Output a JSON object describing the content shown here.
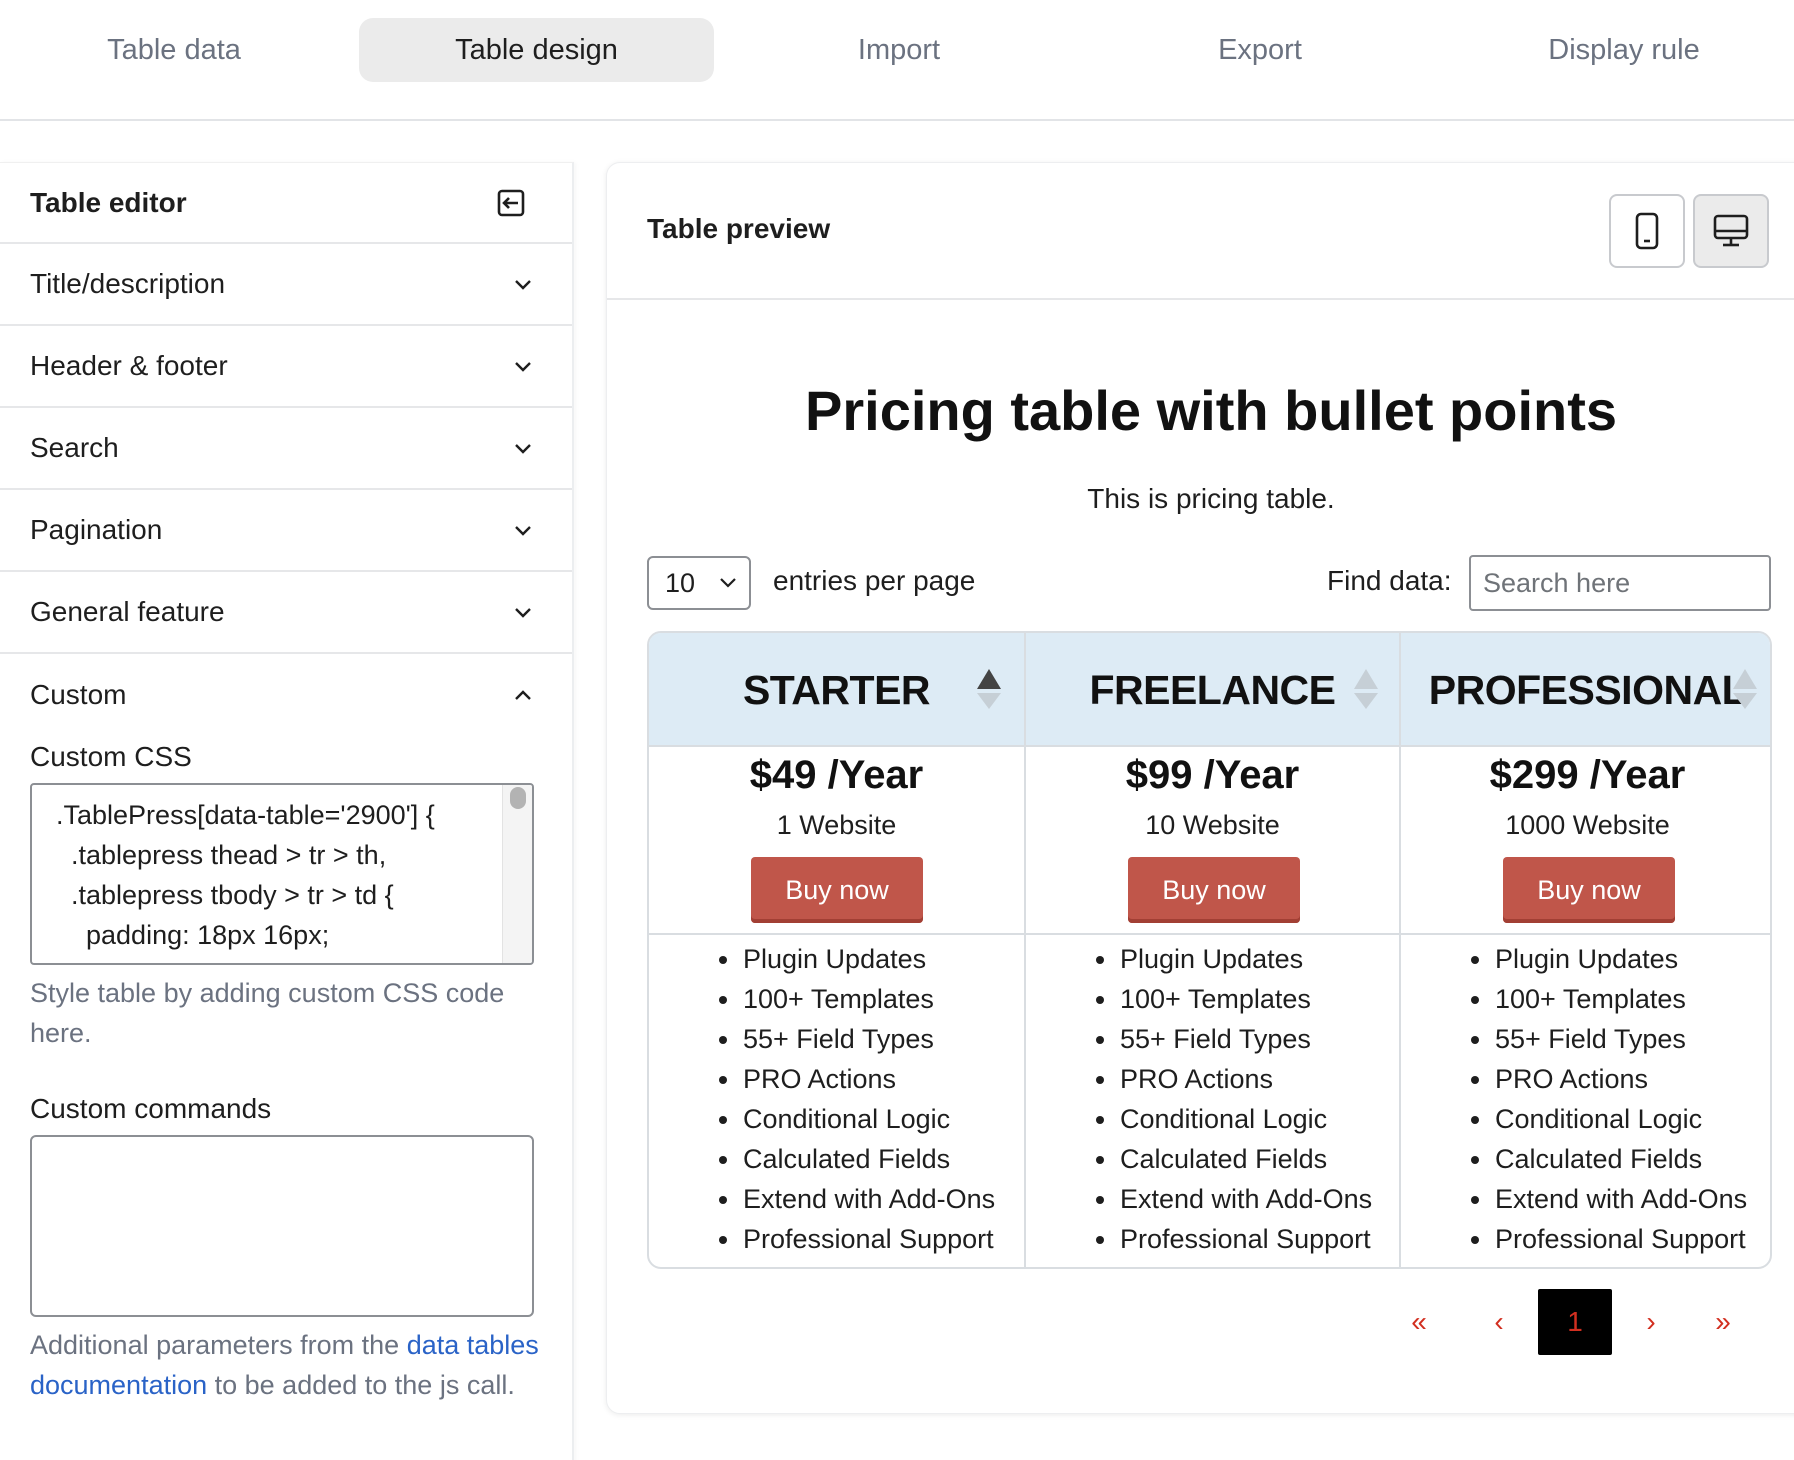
{
  "tabs": [
    {
      "label": "Table data",
      "active": false
    },
    {
      "label": "Table design",
      "active": true
    },
    {
      "label": "Import",
      "active": false
    },
    {
      "label": "Export",
      "active": false
    },
    {
      "label": "Display rule",
      "active": false
    }
  ],
  "editor": {
    "title": "Table editor",
    "collapse_icon": "collapse-panel-icon",
    "sections": [
      {
        "label": "Title/description",
        "open": false
      },
      {
        "label": "Header & footer",
        "open": false
      },
      {
        "label": "Search",
        "open": false
      },
      {
        "label": "Pagination",
        "open": false
      },
      {
        "label": "General feature",
        "open": false
      },
      {
        "label": "Custom",
        "open": true
      }
    ],
    "custom": {
      "css_label": "Custom CSS",
      "css_value": ".TablePress[data-table='2900'] {\n  .tablepress thead > tr > th,\n  .tablepress tbody > tr > td {\n    padding: 18px 16px;",
      "css_help": "Style table by adding custom CSS code here.",
      "commands_label": "Custom commands",
      "commands_value": "",
      "commands_help_pre": "Additional parameters from the ",
      "commands_help_link": "data tables documentation",
      "commands_help_post": " to be added to the js call."
    }
  },
  "preview": {
    "title": "Table preview",
    "mobile_icon": "mobile-icon",
    "desktop_icon": "desktop-icon",
    "table_title": "Pricing table with bullet points",
    "table_description": "This is pricing table.",
    "length_value": "10",
    "length_label": "entries per page",
    "find_label": "Find data:",
    "search_placeholder": "Search here",
    "accent_color": "#c0564a",
    "header_bg": "#ddebf5",
    "columns": [
      {
        "name": "STARTER",
        "sort": "asc",
        "price": "$49 /Year",
        "sites": "1 Website",
        "button": "Buy now",
        "features": [
          "Plugin Updates",
          "100+ Templates",
          "55+ Field Types",
          "PRO Actions",
          "Conditional Logic",
          "Calculated Fields",
          "Extend with Add-Ons",
          "Professional Support"
        ]
      },
      {
        "name": "FREELANCE",
        "sort": "none",
        "price": "$99 /Year",
        "sites": "10 Website",
        "button": "Buy now",
        "features": [
          "Plugin Updates",
          "100+ Templates",
          "55+ Field Types",
          "PRO Actions",
          "Conditional Logic",
          "Calculated Fields",
          "Extend with Add-Ons",
          "Professional Support"
        ]
      },
      {
        "name": "PROFESSIONAL",
        "sort": "none",
        "price": "$299 /Year",
        "sites": "1000 Website",
        "button": "Buy now",
        "features": [
          "Plugin Updates",
          "100+ Templates",
          "55+ Field Types",
          "PRO Actions",
          "Conditional Logic",
          "Calculated Fields",
          "Extend with Add-Ons",
          "Professional Support"
        ]
      }
    ],
    "pagination": {
      "first": "«",
      "prev": "‹",
      "current": "1",
      "next": "›",
      "last": "»"
    }
  }
}
